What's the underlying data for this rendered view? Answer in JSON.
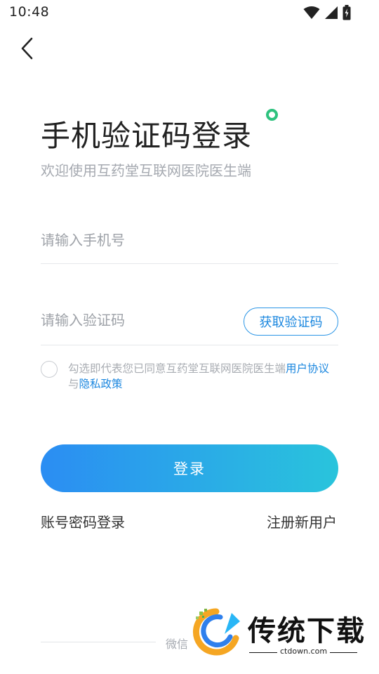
{
  "status_bar": {
    "time": "10:48",
    "icons": [
      "wifi-icon",
      "signal-icon",
      "battery-icon"
    ]
  },
  "header": {
    "back_icon": "chevron-left-icon"
  },
  "title": "手机验证码登录",
  "subtitle": "欢迎使用互药堂互联网医院医生端",
  "phone_field": {
    "placeholder": "请输入手机号",
    "value": ""
  },
  "code_field": {
    "placeholder": "请输入验证码",
    "value": ""
  },
  "get_code_button": "获取验证码",
  "agreement": {
    "prefix": "勾选即代表您已同意互药堂互联网医院医生端",
    "user_agreement": "用户协议",
    "conjunction": "与",
    "privacy_policy": "隐私政策",
    "checked": false
  },
  "login_button": "登录",
  "password_login": "账号密码登录",
  "register": "注册新用户",
  "wechat_label": "微信",
  "watermark": {
    "name": "传统下载",
    "url": "ctdown.com"
  },
  "colors": {
    "accent": "#1b87df",
    "gradient_start": "#2b8df3",
    "gradient_end": "#29c4dc",
    "title_dot": "#2ec27e"
  }
}
